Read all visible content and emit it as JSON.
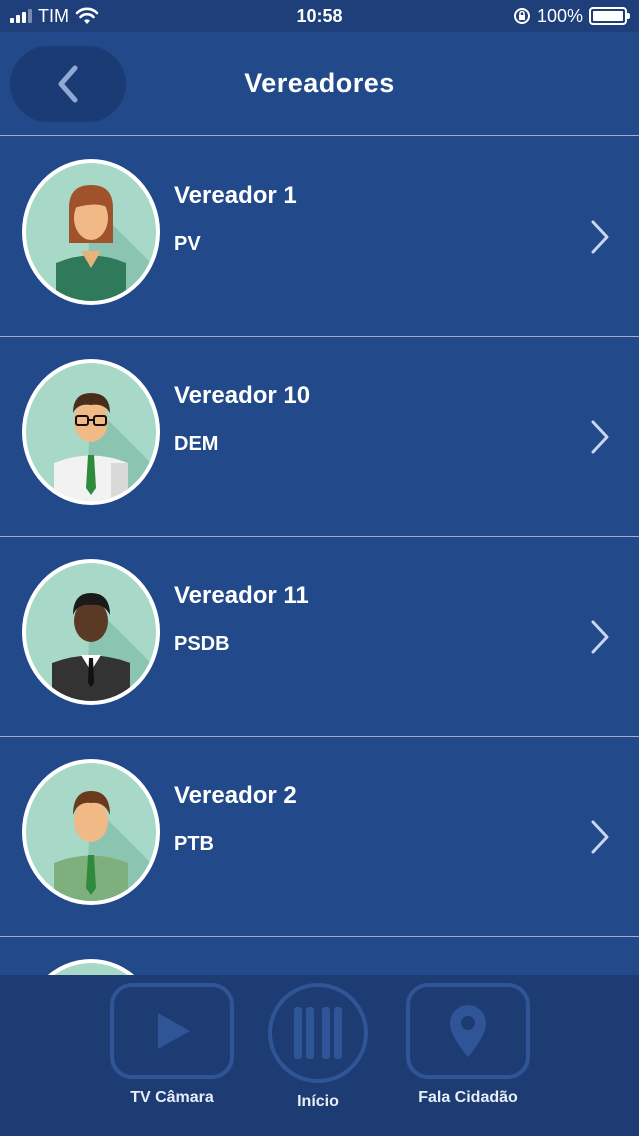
{
  "status_bar": {
    "carrier": "TIM",
    "time": "10:58",
    "battery_percent": "100%",
    "battery_level": 1.0
  },
  "nav": {
    "title": "Vereadores",
    "back_icon": "chevron-left-icon"
  },
  "vereadores": [
    {
      "name": "Vereador 1",
      "party": "PV",
      "avatar": "woman-avatar"
    },
    {
      "name": "Vereador 10",
      "party": "DEM",
      "avatar": "man-glasses-avatar"
    },
    {
      "name": "Vereador 11",
      "party": "PSDB",
      "avatar": "man-suit-avatar"
    },
    {
      "name": "Vereador 2",
      "party": "PTB",
      "avatar": "man-green-avatar"
    }
  ],
  "tab_bar": {
    "tabs": [
      {
        "label": "TV Câmara",
        "icon": "play-icon"
      },
      {
        "label": "Início",
        "icon": "building-columns-icon"
      },
      {
        "label": "Fala Cidadão",
        "icon": "location-pin-icon"
      }
    ]
  },
  "colors": {
    "background": "#22498a",
    "nav": "#22498a",
    "status_bar": "#1e3f7a",
    "tab_bar": "#1d3c73",
    "avatar_bg": "#a8d8c8"
  }
}
